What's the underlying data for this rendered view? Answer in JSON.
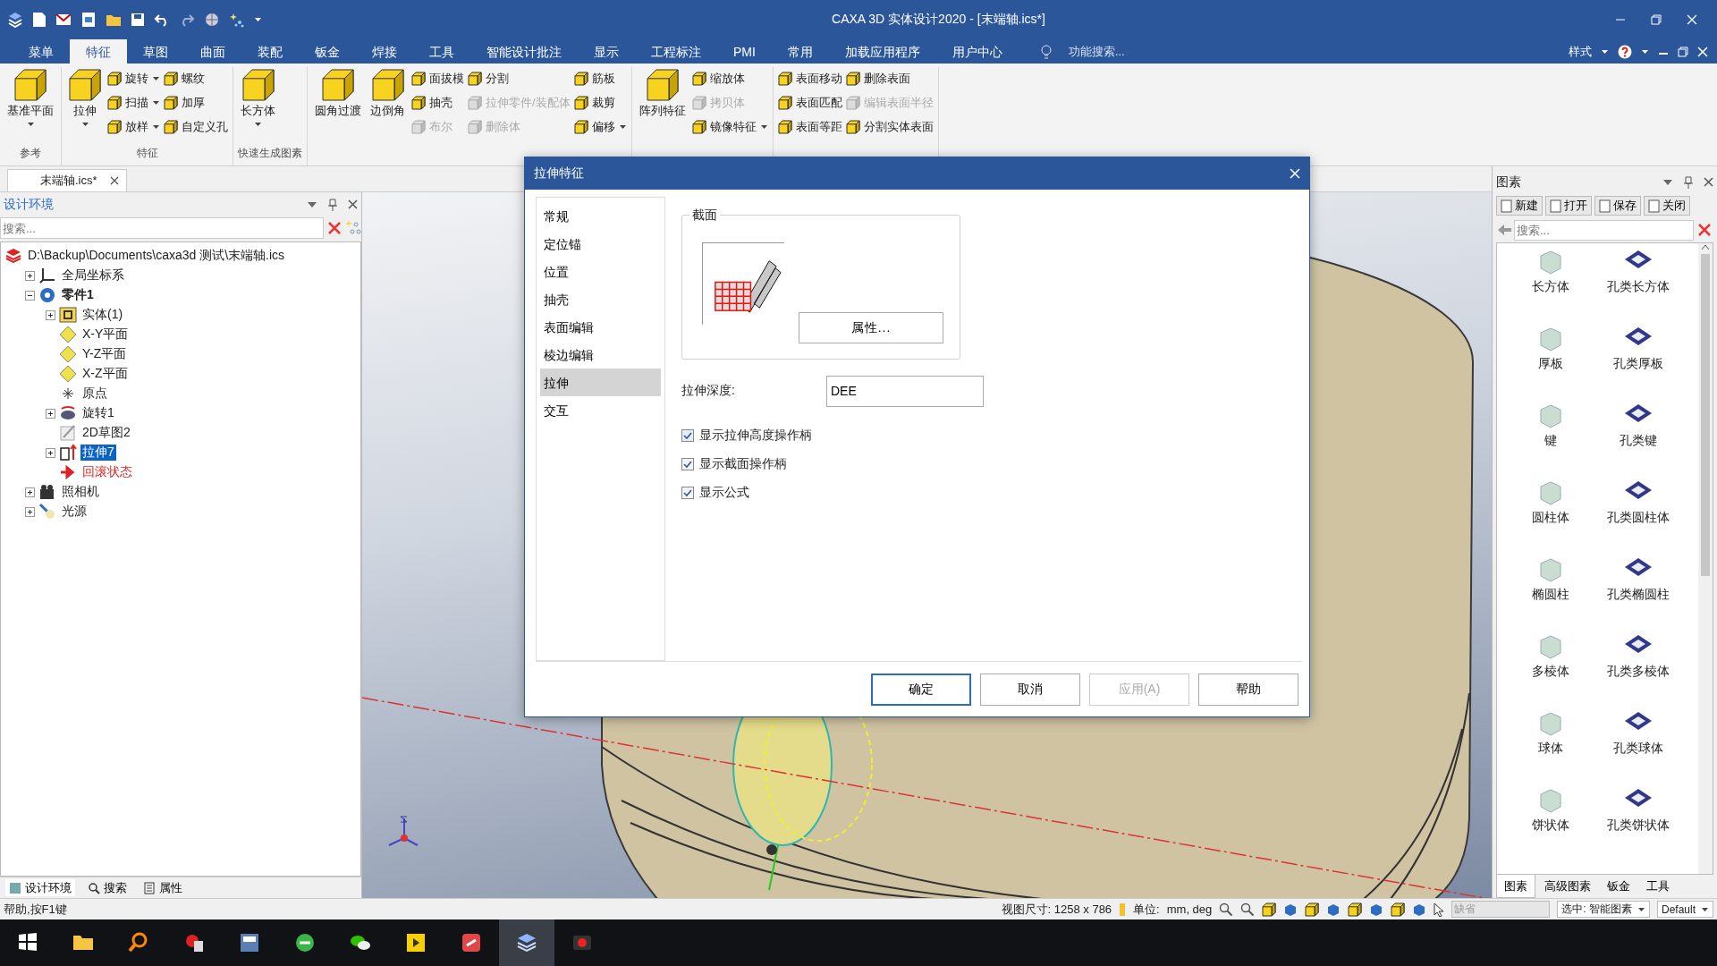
{
  "title_bar": {
    "title": "CAXA 3D 实体设计2020 - [末端轴.ics*]"
  },
  "menu_tabs": [
    {
      "label": "菜单",
      "selected": false
    },
    {
      "label": "特征",
      "selected": true
    },
    {
      "label": "草图",
      "selected": false
    },
    {
      "label": "曲面",
      "selected": false
    },
    {
      "label": "装配",
      "selected": false
    },
    {
      "label": "钣金",
      "selected": false
    },
    {
      "label": "焊接",
      "selected": false
    },
    {
      "label": "工具",
      "selected": false
    },
    {
      "label": "智能设计批注",
      "selected": false
    },
    {
      "label": "显示",
      "selected": false
    },
    {
      "label": "工程标注",
      "selected": false
    },
    {
      "label": "PMI",
      "selected": false
    },
    {
      "label": "常用",
      "selected": false
    },
    {
      "label": "加载应用程序",
      "selected": false
    },
    {
      "label": "用户中心",
      "selected": false
    }
  ],
  "feature_search": {
    "placeholder": "功能搜索..."
  },
  "style_menu": {
    "label": "样式"
  },
  "ribbon_groups": [
    {
      "label": "参考",
      "items": [
        {
          "label": "基准平面",
          "kind": "large",
          "dropdown": true,
          "disabled": false
        }
      ]
    },
    {
      "label": "特征",
      "items": [
        {
          "label": "拉伸",
          "kind": "large",
          "dropdown": true,
          "disabled": false
        },
        {
          "label": "旋转",
          "kind": "small",
          "dropdown": true,
          "disabled": false
        },
        {
          "label": "扫描",
          "kind": "small",
          "dropdown": true,
          "disabled": false
        },
        {
          "label": "放样",
          "kind": "small",
          "dropdown": true,
          "disabled": false
        },
        {
          "label": "螺纹",
          "kind": "small",
          "dropdown": false,
          "disabled": false
        },
        {
          "label": "加厚",
          "kind": "small",
          "dropdown": false,
          "disabled": false
        },
        {
          "label": "自定义孔",
          "kind": "small",
          "dropdown": false,
          "disabled": false
        }
      ]
    },
    {
      "label": "快速生成图素",
      "items": [
        {
          "label": "长方体",
          "kind": "large",
          "dropdown": true,
          "disabled": false
        }
      ]
    },
    {
      "items": [
        {
          "label": "圆角过渡",
          "kind": "large",
          "dropdown": false,
          "disabled": false
        },
        {
          "label": "边倒角",
          "kind": "large",
          "dropdown": false,
          "disabled": false
        },
        {
          "label": "面拔模",
          "kind": "small",
          "dropdown": false,
          "disabled": false
        },
        {
          "label": "抽壳",
          "kind": "small",
          "dropdown": false,
          "disabled": false
        },
        {
          "label": "布尔",
          "kind": "small",
          "dropdown": false,
          "disabled": true
        },
        {
          "label": "分割",
          "kind": "small",
          "dropdown": false,
          "disabled": false
        },
        {
          "label": "拉伸零件/装配体",
          "kind": "small",
          "dropdown": false,
          "disabled": true
        },
        {
          "label": "删除体",
          "kind": "small",
          "dropdown": false,
          "disabled": true
        },
        {
          "label": "筋板",
          "kind": "small",
          "dropdown": false,
          "disabled": false
        },
        {
          "label": "裁剪",
          "kind": "small",
          "dropdown": false,
          "disabled": false
        },
        {
          "label": "偏移",
          "kind": "small",
          "dropdown": true,
          "disabled": false
        }
      ]
    },
    {
      "items": [
        {
          "label": "阵列特征",
          "kind": "large",
          "dropdown": false,
          "disabled": false
        },
        {
          "label": "缩放体",
          "kind": "small",
          "dropdown": false,
          "disabled": false
        },
        {
          "label": "拷贝体",
          "kind": "small",
          "dropdown": false,
          "disabled": true
        },
        {
          "label": "镜像特征",
          "kind": "small",
          "dropdown": true,
          "disabled": false
        }
      ]
    },
    {
      "items": [
        {
          "label": "表面移动",
          "kind": "small",
          "dropdown": false,
          "disabled": false
        },
        {
          "label": "表面匹配",
          "kind": "small",
          "dropdown": false,
          "disabled": false
        },
        {
          "label": "表面等距",
          "kind": "small",
          "dropdown": false,
          "disabled": false
        },
        {
          "label": "删除表面",
          "kind": "small",
          "dropdown": false,
          "disabled": false
        },
        {
          "label": "编辑表面半径",
          "kind": "small",
          "dropdown": false,
          "disabled": true
        },
        {
          "label": "分割实体表面",
          "kind": "small",
          "dropdown": false,
          "disabled": false
        }
      ]
    }
  ],
  "document_tab": {
    "label": "末端轴.ics*"
  },
  "design_panel": {
    "title": "设计环境",
    "search": {
      "placeholder": "搜索..."
    },
    "tree": [
      {
        "label": "D:\\Backup\\Documents\\caxa3d 测试\\末端轴.ics",
        "kind": "file",
        "selected": false,
        "children": [
          {
            "label": "全局坐标系",
            "kind": "axes",
            "selected": false,
            "expanded": false
          },
          {
            "label": "零件1",
            "kind": "part",
            "selected": false,
            "expanded": true,
            "children": [
              {
                "label": "实体(1)",
                "kind": "folder",
                "selected": false,
                "expanded": false
              },
              {
                "label": "X-Y平面",
                "kind": "plane",
                "selected": false
              },
              {
                "label": "Y-Z平面",
                "kind": "plane",
                "selected": false
              },
              {
                "label": "X-Z平面",
                "kind": "plane",
                "selected": false
              },
              {
                "label": "原点",
                "kind": "point",
                "selected": false
              },
              {
                "label": "旋转1",
                "kind": "revolve",
                "selected": false,
                "expanded": false
              },
              {
                "label": "2D草图2",
                "kind": "sketch",
                "selected": false
              },
              {
                "label": "拉伸7",
                "kind": "extrude",
                "selected": true,
                "expanded": false
              },
              {
                "label": "回滚状态",
                "kind": "rollback",
                "selected": false
              }
            ]
          },
          {
            "label": "照相机",
            "kind": "camera",
            "selected": false,
            "expanded": false
          },
          {
            "label": "光源",
            "kind": "light",
            "selected": false,
            "expanded": false
          }
        ]
      }
    ],
    "bottom_tabs": [
      {
        "label": "设计环境",
        "selected": true
      },
      {
        "label": "搜索",
        "selected": false
      },
      {
        "label": "属性",
        "selected": false
      }
    ]
  },
  "dialog": {
    "title": "拉伸特征",
    "nav": [
      {
        "label": "常规",
        "selected": false
      },
      {
        "label": "定位锚",
        "selected": false
      },
      {
        "label": "位置",
        "selected": false
      },
      {
        "label": "抽壳",
        "selected": false
      },
      {
        "label": "表面编辑",
        "selected": false
      },
      {
        "label": "棱边编辑",
        "selected": false
      },
      {
        "label": "拉伸",
        "selected": true
      },
      {
        "label": "交互",
        "selected": false
      }
    ],
    "section_group": {
      "title": "截面",
      "button": "属性..."
    },
    "depth": {
      "label": "拉伸深度:",
      "value": "DEE"
    },
    "checkboxes": [
      {
        "label": "显示拉伸高度操作柄",
        "checked": true
      },
      {
        "label": "显示截面操作柄",
        "checked": true
      },
      {
        "label": "显示公式",
        "checked": true
      }
    ],
    "buttons": [
      {
        "label": "确定",
        "default": true,
        "disabled": false
      },
      {
        "label": "取消",
        "default": false,
        "disabled": false
      },
      {
        "label": "应用(A)",
        "default": false,
        "disabled": true
      },
      {
        "label": "帮助",
        "default": false,
        "disabled": false
      }
    ]
  },
  "elements_panel": {
    "title": "图素",
    "toolbar": [
      {
        "label": "新建"
      },
      {
        "label": "打开"
      },
      {
        "label": "保存"
      },
      {
        "label": "关闭"
      }
    ],
    "search": {
      "placeholder": "搜索..."
    },
    "items": [
      {
        "label": "长方体",
        "kind": "solid"
      },
      {
        "label": "孔类长方体",
        "kind": "hole"
      },
      {
        "label": "厚板",
        "kind": "solid"
      },
      {
        "label": "孔类厚板",
        "kind": "hole"
      },
      {
        "label": "键",
        "kind": "solid"
      },
      {
        "label": "孔类键",
        "kind": "hole"
      },
      {
        "label": "圆柱体",
        "kind": "solid"
      },
      {
        "label": "孔类圆柱体",
        "kind": "hole"
      },
      {
        "label": "椭圆柱",
        "kind": "solid"
      },
      {
        "label": "孔类椭圆柱",
        "kind": "hole"
      },
      {
        "label": "多棱体",
        "kind": "solid"
      },
      {
        "label": "孔类多棱体",
        "kind": "hole"
      },
      {
        "label": "球体",
        "kind": "solid"
      },
      {
        "label": "孔类球体",
        "kind": "hole"
      },
      {
        "label": "饼状体",
        "kind": "solid"
      },
      {
        "label": "孔类饼状体",
        "kind": "hole"
      }
    ],
    "tabs": [
      {
        "label": "图素",
        "selected": true
      },
      {
        "label": "高级图素",
        "selected": false
      },
      {
        "label": "钣金",
        "selected": false
      },
      {
        "label": "工具",
        "selected": false
      }
    ]
  },
  "status_bar": {
    "help": "帮助,按F1键",
    "view_size": "视图尺寸: 1258 x 786",
    "units_label": "单位:",
    "units": "mm, deg",
    "filter_field": {
      "value": "缺省",
      "disabled": true
    },
    "selection": "选中: 智能图素",
    "style": "Default"
  }
}
